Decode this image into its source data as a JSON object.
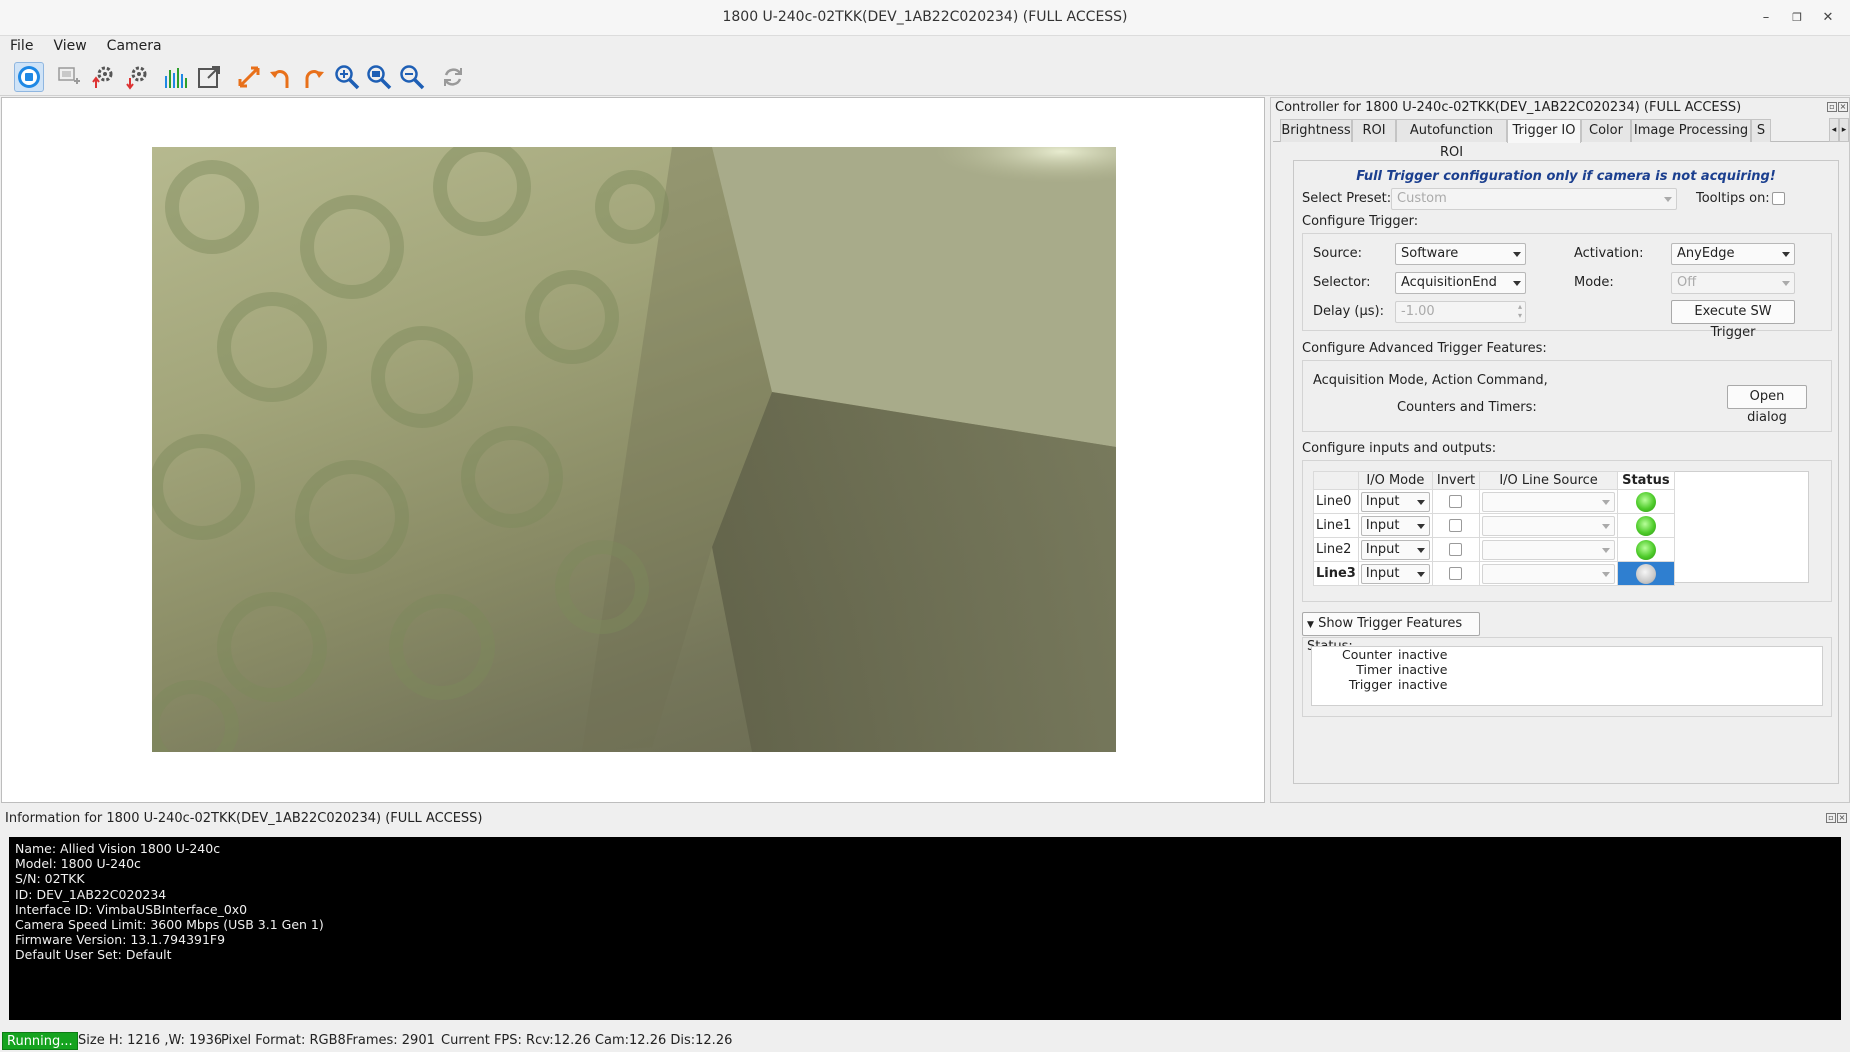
{
  "window": {
    "title": "1800 U-240c-02TKK(DEV_1AB22C020234) (FULL ACCESS)"
  },
  "menu": [
    "File",
    "View",
    "Camera"
  ],
  "toolbar": [
    {
      "name": "stop-acquisition-icon"
    },
    {
      "name": "open-camera-icon"
    },
    {
      "name": "load-settings-icon"
    },
    {
      "name": "save-settings-icon"
    },
    {
      "name": "histogram-icon"
    },
    {
      "name": "open-external-icon"
    },
    {
      "name": "fit-to-window-icon"
    },
    {
      "name": "rotate-left-icon"
    },
    {
      "name": "rotate-right-icon"
    },
    {
      "name": "zoom-in-icon"
    },
    {
      "name": "zoom-fit-icon"
    },
    {
      "name": "zoom-out-icon"
    },
    {
      "name": "refresh-icon"
    }
  ],
  "controller": {
    "title": "Controller for 1800 U-240c-02TKK(DEV_1AB22C020234) (FULL ACCESS)",
    "tabs": [
      "Brightness",
      "ROI",
      "Autofunction ROI",
      "Trigger IO",
      "Color",
      "Image Processing",
      "S"
    ],
    "active_tab": "Trigger IO",
    "warning": "Full Trigger configuration only if camera is not acquiring!",
    "select_preset_label": "Select Preset:",
    "select_preset_value": "Custom",
    "tooltips_label": "Tooltips on:",
    "configure_trigger_label": "Configure Trigger:",
    "source_label": "Source:",
    "source_value": "Software",
    "activation_label": "Activation:",
    "activation_value": "AnyEdge",
    "selector_label": "Selector:",
    "selector_value": "AcquisitionEnd",
    "mode_label": "Mode:",
    "mode_value": "Off",
    "delay_label": "Delay (µs):",
    "delay_value": "-1.00",
    "execute_button": "Execute SW Trigger",
    "advanced_label": "Configure Advanced Trigger Features:",
    "advanced_text_1": "Acquisition Mode, Action Command,",
    "advanced_text_2": "Counters and Timers:",
    "open_dialog_button": "Open dialog",
    "io_label": "Configure inputs and outputs:",
    "io_headers": [
      "I/O Mode",
      "Invert",
      "I/O Line Source",
      "Status"
    ],
    "io_lines": [
      {
        "name": "Line0",
        "mode": "Input",
        "status": "on"
      },
      {
        "name": "Line1",
        "mode": "Input",
        "status": "on"
      },
      {
        "name": "Line2",
        "mode": "Input",
        "status": "on"
      },
      {
        "name": "Line3",
        "mode": "Input",
        "status": "off"
      }
    ],
    "show_status_label": "Show Trigger Features Status:",
    "features_status": [
      {
        "name": "Counter",
        "value": "inactive"
      },
      {
        "name": "Timer",
        "value": "inactive"
      },
      {
        "name": "Trigger",
        "value": "inactive"
      }
    ]
  },
  "info": {
    "title": "Information for 1800 U-240c-02TKK(DEV_1AB22C020234) (FULL ACCESS)",
    "lines": [
      "Name: Allied Vision 1800 U-240c",
      "Model: 1800 U-240c",
      "S/N: 02TKK",
      "ID: DEV_1AB22C020234",
      "Interface ID: VimbaUSBInterface_0x0",
      "Camera Speed Limit: 3600 Mbps (USB 3.1 Gen 1)",
      "Firmware Version: 13.1.794391F9",
      "Default User Set: Default"
    ]
  },
  "status": {
    "running": "Running...",
    "size": "Size H: 1216 ,W: 1936",
    "pixel_format": "Pixel Format: RGB8",
    "frames": "Frames: 2901",
    "fps": "Current FPS: Rcv:12.26 Cam:12.26 Dis:12.26"
  },
  "colors": {
    "accent": "#1e88e5",
    "toolbar_orange": "#e8701a",
    "running_green": "#15a31f",
    "selected_cell": "#2f7fd0",
    "warning_text": "#1b3f8f"
  }
}
